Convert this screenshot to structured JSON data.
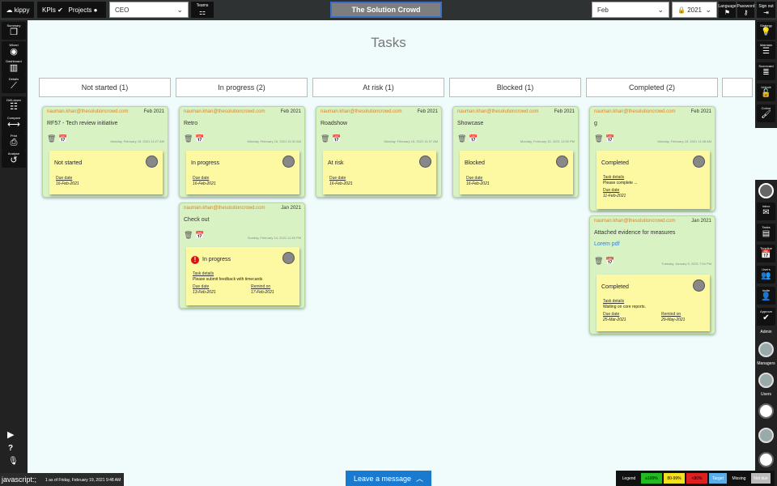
{
  "topbar": {
    "logo": "kippy",
    "kpis_label": "KPIs",
    "projects_label": "Projects",
    "role_select": "CEO",
    "teams_label": "Teams",
    "company": "The Solution Crowd",
    "month_select": "Feb",
    "year_select": "2021",
    "language_label": "Language",
    "password_label": "Password",
    "signout_label": "Sign out"
  },
  "leftbar": [
    {
      "label": "Summary",
      "icon": "copy-icon"
    },
    {
      "label": "Wheel",
      "icon": "wheel-icon"
    },
    {
      "label": "Dashboard",
      "icon": "bar-chart-icon"
    },
    {
      "label": "Details",
      "icon": "line-chart-icon"
    },
    {
      "label": "Drill-down",
      "icon": "drill-icon"
    },
    {
      "label": "Compare",
      "icon": "compare-icon"
    },
    {
      "label": "Print",
      "icon": "print-icon"
    },
    {
      "label": "Analyse",
      "icon": "history-icon"
    }
  ],
  "rightbar_top": [
    {
      "label": "Strategy",
      "icon": "bulb-icon"
    },
    {
      "label": "Maintain",
      "icon": "sliders-icon"
    },
    {
      "label": "Scorecard",
      "icon": "list-icon"
    },
    {
      "label": "Unlock",
      "icon": "unlock-icon"
    },
    {
      "label": "Colour",
      "icon": "brush-icon"
    }
  ],
  "rightbar_bottom": {
    "buttons": [
      {
        "label": "Inbox",
        "icon": "mail-icon"
      },
      {
        "label": "Tasks",
        "icon": "tasks-icon"
      },
      {
        "label": "Timeline",
        "icon": "calendar-icon"
      },
      {
        "label": "Users",
        "icon": "users-icon"
      },
      {
        "label": "Invite",
        "icon": "add-user-icon"
      },
      {
        "label": "Approve",
        "icon": "check-icon"
      }
    ],
    "admin_label": "Admin",
    "managers_label": "Managers",
    "users_label": "Users"
  },
  "page_title": "Tasks",
  "columns": [
    "Not started (1)",
    "In progress (2)",
    "At risk (1)",
    "Blocked (1)",
    "Completed (2)"
  ],
  "cards": [
    {
      "email": "nauman.khan@thesolutioncrowd.com",
      "date": "Feb 2021",
      "title": "RF57 - Tech review initiative",
      "stamp": "Monday, February 15, 2021 11:27 AM",
      "status": "Not started",
      "due_label": "Due date",
      "due": "16-Feb-2021"
    },
    {
      "email": "nauman.khan@thesolutioncrowd.com",
      "date": "Feb 2021",
      "title": "Retro",
      "stamp": "Monday, February 15, 2021 11:31 AM",
      "status": "In progress",
      "due_label": "Due date",
      "due": "16-Feb-2021"
    },
    {
      "email": "nauman.khan@thesolutioncrowd.com",
      "date": "Feb 2021",
      "title": "Roadshow",
      "stamp": "Monday, February 15, 2021 11:37 AM",
      "status": "At risk",
      "due_label": "Due date",
      "due": "16-Feb-2021"
    },
    {
      "email": "nauman.khan@thesolutioncrowd.com",
      "date": "Feb 2021",
      "title": "Showcase",
      "stamp": "Monday, February 15, 2021 12:00 PM",
      "status": "Blocked",
      "due_label": "Due date",
      "due": "16-Feb-2021"
    },
    {
      "email": "nauman.khan@thesolutioncrowd.com",
      "date": "Feb 2021",
      "title": "g",
      "stamp": "Monday, February 15, 2021 11:48 AM",
      "status": "Completed",
      "details_label": "Task details",
      "details": "Please complete ...",
      "due_label": "Due date",
      "due": "11-Feb-2021"
    },
    {
      "email": "nauman.khan@thesolutioncrowd.com",
      "date": "Jan 2021",
      "title": "Check out",
      "stamp": "Sunday, February 14, 2021 11:46 PM",
      "status": "In progress",
      "details_label": "Task details",
      "details": "Please submit feedback with timecards",
      "due_label": "Due date",
      "due": "13-Feb-2021",
      "remind_label": "Remind on",
      "remind": "17-Feb-2021"
    },
    {
      "email": "nauman.khan@thesolutioncrowd.com",
      "date": "Jan 2021",
      "title": "Attached evidence for measures",
      "link": "Lorem pdf",
      "stamp": "Tuesday, January 5, 2021 7:54 PM",
      "status": "Completed",
      "details_label": "Task details",
      "details": "Waiting on core reports.",
      "due_label": "Due date",
      "due": "25-Mar-2021",
      "remind_label": "Remind on",
      "remind": "29-May-2021"
    }
  ],
  "footer": {
    "js_status": "javascript:;",
    "last_login": "1 as of Friday, February 19, 2021 9:48 AM",
    "leave_message": "Leave a message",
    "legend_label": "Legend",
    "legend": [
      {
        "text": "≥100%",
        "color": "#22bb22"
      },
      {
        "text": "80-99%",
        "color": "#f5e020"
      },
      {
        "text": "<80%",
        "color": "#e02020"
      },
      {
        "text": "Target",
        "color": "#5aaeea"
      },
      {
        "text": "Missing",
        "color": "#111111"
      },
      {
        "text": "Not due",
        "color": "#bbbbbb"
      }
    ]
  }
}
